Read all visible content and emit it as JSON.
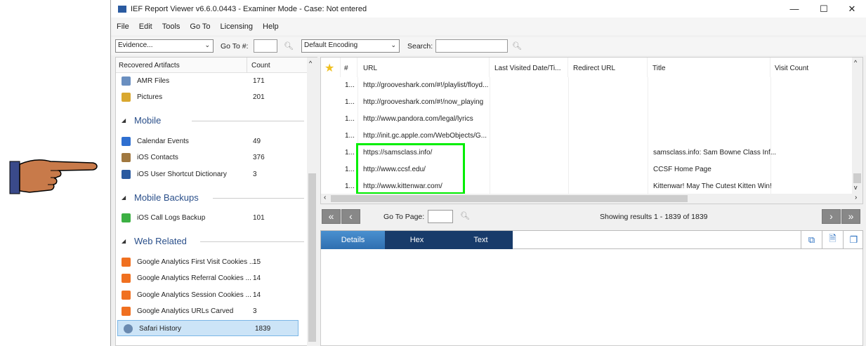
{
  "window": {
    "title": "IEF Report Viewer v6.6.0.0443 - Examiner Mode - Case: Not entered",
    "controls": [
      "—",
      "☐",
      "✕"
    ]
  },
  "menu": [
    "File",
    "Edit",
    "Tools",
    "Go To",
    "Licensing",
    "Help"
  ],
  "toolbar": {
    "evidence": "Evidence...",
    "goto_label": "Go To #:",
    "encoding": "Default Encoding",
    "search_label": "Search:"
  },
  "left": {
    "header": {
      "name": "Recovered Artifacts",
      "count": "Count"
    },
    "items_top": [
      {
        "name": "AMR Files",
        "count": "171",
        "color": "#6a8fc0"
      },
      {
        "name": "Pictures",
        "count": "201",
        "color": "#d9a830"
      }
    ],
    "groups": [
      {
        "label": "Mobile",
        "items": [
          {
            "name": "Calendar Events",
            "count": "49",
            "color": "#2f6fd0"
          },
          {
            "name": "iOS Contacts",
            "count": "376",
            "color": "#a07840"
          },
          {
            "name": "iOS User Shortcut Dictionary",
            "count": "3",
            "color": "#2a5aa0"
          }
        ]
      },
      {
        "label": "Mobile Backups",
        "items": [
          {
            "name": "iOS Call Logs Backup",
            "count": "101",
            "color": "#3cb043"
          }
        ]
      },
      {
        "label": "Web Related",
        "items": [
          {
            "name": "Google Analytics First Visit Cookies ...",
            "count": "15",
            "color": "#f07020"
          },
          {
            "name": "Google Analytics Referral Cookies ...",
            "count": "14",
            "color": "#f07020"
          },
          {
            "name": "Google Analytics Session Cookies ...",
            "count": "14",
            "color": "#f07020"
          },
          {
            "name": "Google Analytics URLs Carved",
            "count": "3",
            "color": "#f07020"
          },
          {
            "name": "Safari History",
            "count": "1839",
            "color": "#6a8ab0"
          }
        ]
      }
    ],
    "selected": "Safari History"
  },
  "grid": {
    "columns": [
      "#",
      "URL",
      "Last Visited Date/Ti...",
      "Redirect URL",
      "Title",
      "Visit Count"
    ],
    "rows": [
      {
        "num": "1...",
        "url": "http://grooveshark.com/#!/playlist/floyd...",
        "title": ""
      },
      {
        "num": "1...",
        "url": "http://grooveshark.com/#!/now_playing",
        "title": ""
      },
      {
        "num": "1...",
        "url": "http://www.pandora.com/legal/lyrics",
        "title": ""
      },
      {
        "num": "1...",
        "url": "http://init.gc.apple.com/WebObjects/G...",
        "title": ""
      },
      {
        "num": "1...",
        "url": "https://samsclass.info/",
        "title": "samsclass.info: Sam Bowne Class Inf..."
      },
      {
        "num": "1...",
        "url": "http://www.ccsf.edu/",
        "title": "CCSF Home Page"
      },
      {
        "num": "1...",
        "url": "http://www.kittenwar.com/",
        "title": "Kittenwar! May The Cutest Kitten Win!"
      }
    ],
    "highlight_color": "#00ee00"
  },
  "pager": {
    "first": "«",
    "prev": "‹",
    "goto_label": "Go To Page:",
    "status": "Showing results 1 - 1839 of 1839",
    "next": "›",
    "last": "»"
  },
  "tabs": [
    "Details",
    "Hex",
    "Text"
  ]
}
